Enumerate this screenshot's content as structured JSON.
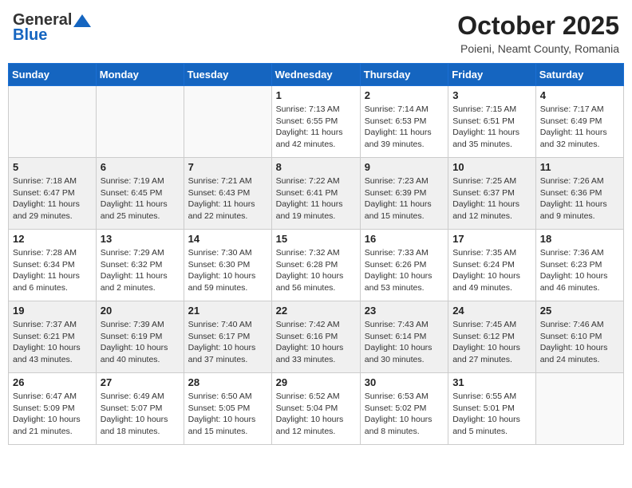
{
  "header": {
    "logo_general": "General",
    "logo_blue": "Blue",
    "month": "October 2025",
    "location": "Poieni, Neamt County, Romania"
  },
  "weekdays": [
    "Sunday",
    "Monday",
    "Tuesday",
    "Wednesday",
    "Thursday",
    "Friday",
    "Saturday"
  ],
  "weeks": [
    [
      {
        "day": "",
        "info": ""
      },
      {
        "day": "",
        "info": ""
      },
      {
        "day": "",
        "info": ""
      },
      {
        "day": "1",
        "info": "Sunrise: 7:13 AM\nSunset: 6:55 PM\nDaylight: 11 hours\nand 42 minutes."
      },
      {
        "day": "2",
        "info": "Sunrise: 7:14 AM\nSunset: 6:53 PM\nDaylight: 11 hours\nand 39 minutes."
      },
      {
        "day": "3",
        "info": "Sunrise: 7:15 AM\nSunset: 6:51 PM\nDaylight: 11 hours\nand 35 minutes."
      },
      {
        "day": "4",
        "info": "Sunrise: 7:17 AM\nSunset: 6:49 PM\nDaylight: 11 hours\nand 32 minutes."
      }
    ],
    [
      {
        "day": "5",
        "info": "Sunrise: 7:18 AM\nSunset: 6:47 PM\nDaylight: 11 hours\nand 29 minutes."
      },
      {
        "day": "6",
        "info": "Sunrise: 7:19 AM\nSunset: 6:45 PM\nDaylight: 11 hours\nand 25 minutes."
      },
      {
        "day": "7",
        "info": "Sunrise: 7:21 AM\nSunset: 6:43 PM\nDaylight: 11 hours\nand 22 minutes."
      },
      {
        "day": "8",
        "info": "Sunrise: 7:22 AM\nSunset: 6:41 PM\nDaylight: 11 hours\nand 19 minutes."
      },
      {
        "day": "9",
        "info": "Sunrise: 7:23 AM\nSunset: 6:39 PM\nDaylight: 11 hours\nand 15 minutes."
      },
      {
        "day": "10",
        "info": "Sunrise: 7:25 AM\nSunset: 6:37 PM\nDaylight: 11 hours\nand 12 minutes."
      },
      {
        "day": "11",
        "info": "Sunrise: 7:26 AM\nSunset: 6:36 PM\nDaylight: 11 hours\nand 9 minutes."
      }
    ],
    [
      {
        "day": "12",
        "info": "Sunrise: 7:28 AM\nSunset: 6:34 PM\nDaylight: 11 hours\nand 6 minutes."
      },
      {
        "day": "13",
        "info": "Sunrise: 7:29 AM\nSunset: 6:32 PM\nDaylight: 11 hours\nand 2 minutes."
      },
      {
        "day": "14",
        "info": "Sunrise: 7:30 AM\nSunset: 6:30 PM\nDaylight: 10 hours\nand 59 minutes."
      },
      {
        "day": "15",
        "info": "Sunrise: 7:32 AM\nSunset: 6:28 PM\nDaylight: 10 hours\nand 56 minutes."
      },
      {
        "day": "16",
        "info": "Sunrise: 7:33 AM\nSunset: 6:26 PM\nDaylight: 10 hours\nand 53 minutes."
      },
      {
        "day": "17",
        "info": "Sunrise: 7:35 AM\nSunset: 6:24 PM\nDaylight: 10 hours\nand 49 minutes."
      },
      {
        "day": "18",
        "info": "Sunrise: 7:36 AM\nSunset: 6:23 PM\nDaylight: 10 hours\nand 46 minutes."
      }
    ],
    [
      {
        "day": "19",
        "info": "Sunrise: 7:37 AM\nSunset: 6:21 PM\nDaylight: 10 hours\nand 43 minutes."
      },
      {
        "day": "20",
        "info": "Sunrise: 7:39 AM\nSunset: 6:19 PM\nDaylight: 10 hours\nand 40 minutes."
      },
      {
        "day": "21",
        "info": "Sunrise: 7:40 AM\nSunset: 6:17 PM\nDaylight: 10 hours\nand 37 minutes."
      },
      {
        "day": "22",
        "info": "Sunrise: 7:42 AM\nSunset: 6:16 PM\nDaylight: 10 hours\nand 33 minutes."
      },
      {
        "day": "23",
        "info": "Sunrise: 7:43 AM\nSunset: 6:14 PM\nDaylight: 10 hours\nand 30 minutes."
      },
      {
        "day": "24",
        "info": "Sunrise: 7:45 AM\nSunset: 6:12 PM\nDaylight: 10 hours\nand 27 minutes."
      },
      {
        "day": "25",
        "info": "Sunrise: 7:46 AM\nSunset: 6:10 PM\nDaylight: 10 hours\nand 24 minutes."
      }
    ],
    [
      {
        "day": "26",
        "info": "Sunrise: 6:47 AM\nSunset: 5:09 PM\nDaylight: 10 hours\nand 21 minutes."
      },
      {
        "day": "27",
        "info": "Sunrise: 6:49 AM\nSunset: 5:07 PM\nDaylight: 10 hours\nand 18 minutes."
      },
      {
        "day": "28",
        "info": "Sunrise: 6:50 AM\nSunset: 5:05 PM\nDaylight: 10 hours\nand 15 minutes."
      },
      {
        "day": "29",
        "info": "Sunrise: 6:52 AM\nSunset: 5:04 PM\nDaylight: 10 hours\nand 12 minutes."
      },
      {
        "day": "30",
        "info": "Sunrise: 6:53 AM\nSunset: 5:02 PM\nDaylight: 10 hours\nand 8 minutes."
      },
      {
        "day": "31",
        "info": "Sunrise: 6:55 AM\nSunset: 5:01 PM\nDaylight: 10 hours\nand 5 minutes."
      },
      {
        "day": "",
        "info": ""
      }
    ]
  ]
}
